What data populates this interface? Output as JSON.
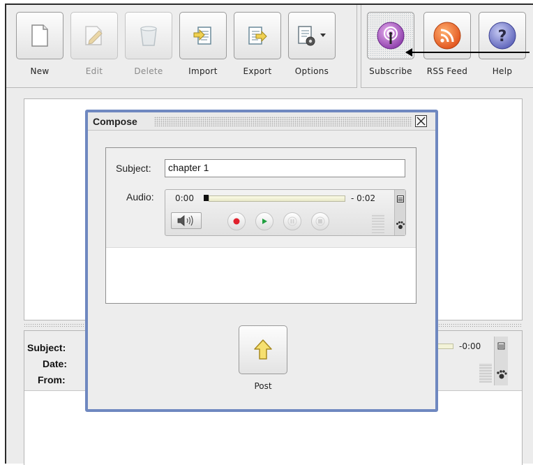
{
  "toolbar": {
    "buttons": [
      {
        "label": "New",
        "icon": "new-document-icon",
        "enabled": true
      },
      {
        "label": "Edit",
        "icon": "edit-pencil-icon",
        "enabled": false
      },
      {
        "label": "Delete",
        "icon": "trash-icon",
        "enabled": false
      },
      {
        "label": "Import",
        "icon": "import-icon",
        "enabled": true
      },
      {
        "label": "Export",
        "icon": "export-icon",
        "enabled": true
      },
      {
        "label": "Options",
        "icon": "options-gear-icon",
        "enabled": true
      }
    ],
    "right_buttons": [
      {
        "label": "Subscribe",
        "icon": "podcast-icon",
        "color": "#9b4fc0"
      },
      {
        "label": "RSS Feed",
        "icon": "rss-icon",
        "color": "#e8641f"
      },
      {
        "label": "Help",
        "icon": "help-icon",
        "color": "#6c72c4"
      }
    ]
  },
  "message_view": {
    "subject_label": "Subject:",
    "date_label": "Date:",
    "from_label": "From:",
    "player_time": "-0:00"
  },
  "compose": {
    "title": "Compose",
    "subject_label": "Subject:",
    "subject_value": "chapter 1",
    "audio_label": "Audio:",
    "player": {
      "elapsed": "0:00",
      "remaining": "- 0:02",
      "progress": 0
    },
    "post_label": "Post"
  },
  "colors": {
    "dialog_border": "#6f88c0",
    "record": "#e0202c",
    "play": "#20a040"
  }
}
